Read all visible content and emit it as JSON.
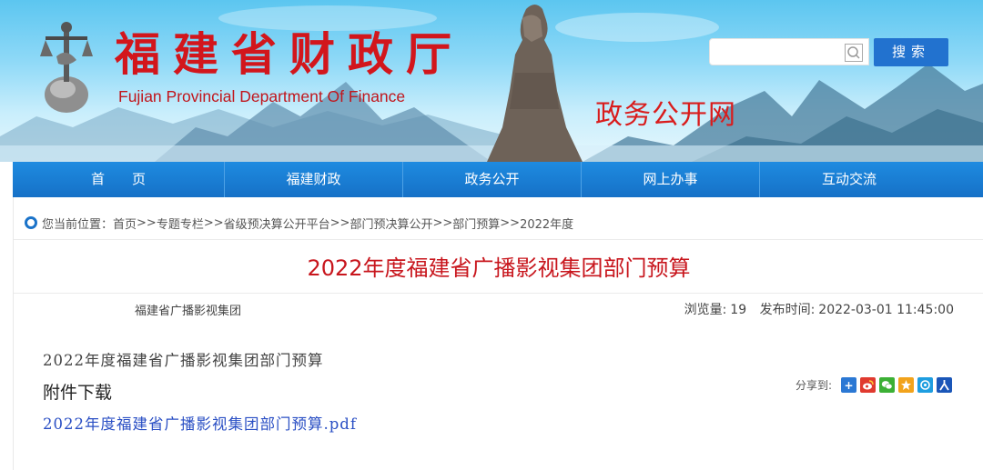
{
  "header": {
    "site_title": "福建省财政厅",
    "site_subtitle": "Fujian Provincial Department Of Finance",
    "portal_title": "政务公开网",
    "search_placeholder": "",
    "search_button": "搜索"
  },
  "nav": {
    "items": [
      {
        "label": "首页"
      },
      {
        "label": "福建财政"
      },
      {
        "label": "政务公开"
      },
      {
        "label": "网上办事"
      },
      {
        "label": "互动交流"
      }
    ]
  },
  "breadcrumb": {
    "label": "您当前位置：",
    "separator": ">>",
    "items": [
      "首页",
      "专题专栏",
      "省级预决算公开平台",
      "部门预决算公开",
      "部门预算",
      "2022年度"
    ]
  },
  "article": {
    "title": "2022年度福建省广播影视集团部门预算",
    "source": "福建省广播影视集团",
    "views_label": "浏览量:",
    "views": "19",
    "published_label": "发布时间:",
    "published": "2022-03-01 11:45:00",
    "body_text": "2022年度福建省广播影视集团部门预算",
    "attachment_heading": "附件下载",
    "attachment_link": "2022年度福建省广播影视集团部门预算.pdf"
  },
  "share": {
    "label": "分享到:",
    "icons": [
      {
        "name": "qzone-plus-icon",
        "color": "#2b78d4",
        "glyph": "+"
      },
      {
        "name": "weibo-icon",
        "color": "#e03a2f",
        "glyph": "微"
      },
      {
        "name": "wechat-icon",
        "color": "#3cb035",
        "glyph": "微"
      },
      {
        "name": "qq-zone-icon",
        "color": "#f2a31b",
        "glyph": "★"
      },
      {
        "name": "tencent-weibo-icon",
        "color": "#1e9de0",
        "glyph": "@"
      },
      {
        "name": "renren-icon",
        "color": "#1a56b8",
        "glyph": "人"
      }
    ]
  },
  "colors": {
    "brand_red": "#d2161c",
    "nav_blue": "#1671c7",
    "search_blue": "#2272cf",
    "title_red": "#c8161d",
    "link_blue": "#2a4fc4"
  }
}
